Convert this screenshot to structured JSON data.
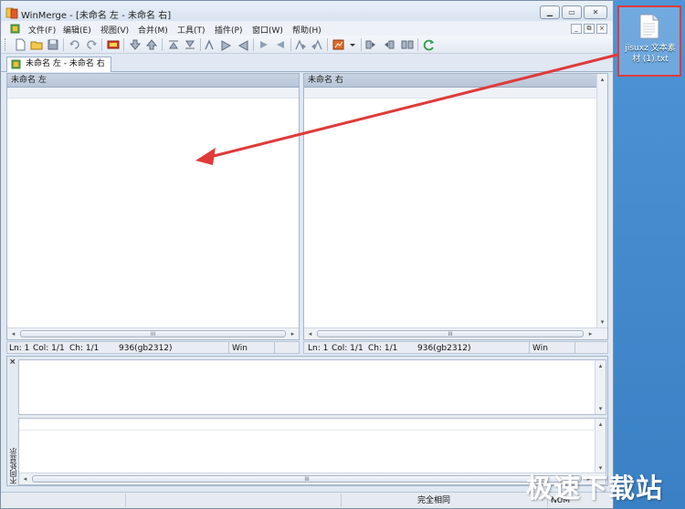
{
  "window": {
    "title": "WinMerge - [未命名 左 - 未命名 右]",
    "caption_minimize": "▁",
    "caption_maximize": "▭",
    "caption_close": "✕"
  },
  "menubar": {
    "items": [
      "文件(F)",
      "编辑(E)",
      "视图(V)",
      "合并(M)",
      "工具(T)",
      "插件(P)",
      "窗口(W)",
      "帮助(H)"
    ],
    "mdi_minimize": "_",
    "mdi_restore": "⧉",
    "mdi_close": "×"
  },
  "tab": {
    "label": "未命名 左 - 未命名 右"
  },
  "left_pane": {
    "header": "未命名 左",
    "status": {
      "ln": "Ln: 1",
      "col": "Col: 1/1",
      "ch": "Ch: 1/1",
      "encoding": "936(gb2312)",
      "eol": "Win"
    }
  },
  "right_pane": {
    "header": "未命名 右",
    "status": {
      "ln": "Ln: 1",
      "col": "Col: 1/1",
      "ch": "Ch: 1/1",
      "encoding": "936(gb2312)",
      "eol": "Win"
    }
  },
  "scroll": {
    "left_arrow": "◂",
    "right_arrow": "▸",
    "up_arrow": "▴",
    "down_arrow": "▾",
    "grip": "III"
  },
  "diff_panel": {
    "close": "×",
    "side_label": "不同处显示"
  },
  "bottom_status": {
    "comparison": "完全相同",
    "num": "NUM"
  },
  "desktop_file": {
    "label": "jisuxz 文本素材 (1).txt"
  },
  "watermark": "极速下载站",
  "colors": {
    "annotation": "#e03a3a",
    "desktop": "#3a80c4"
  }
}
